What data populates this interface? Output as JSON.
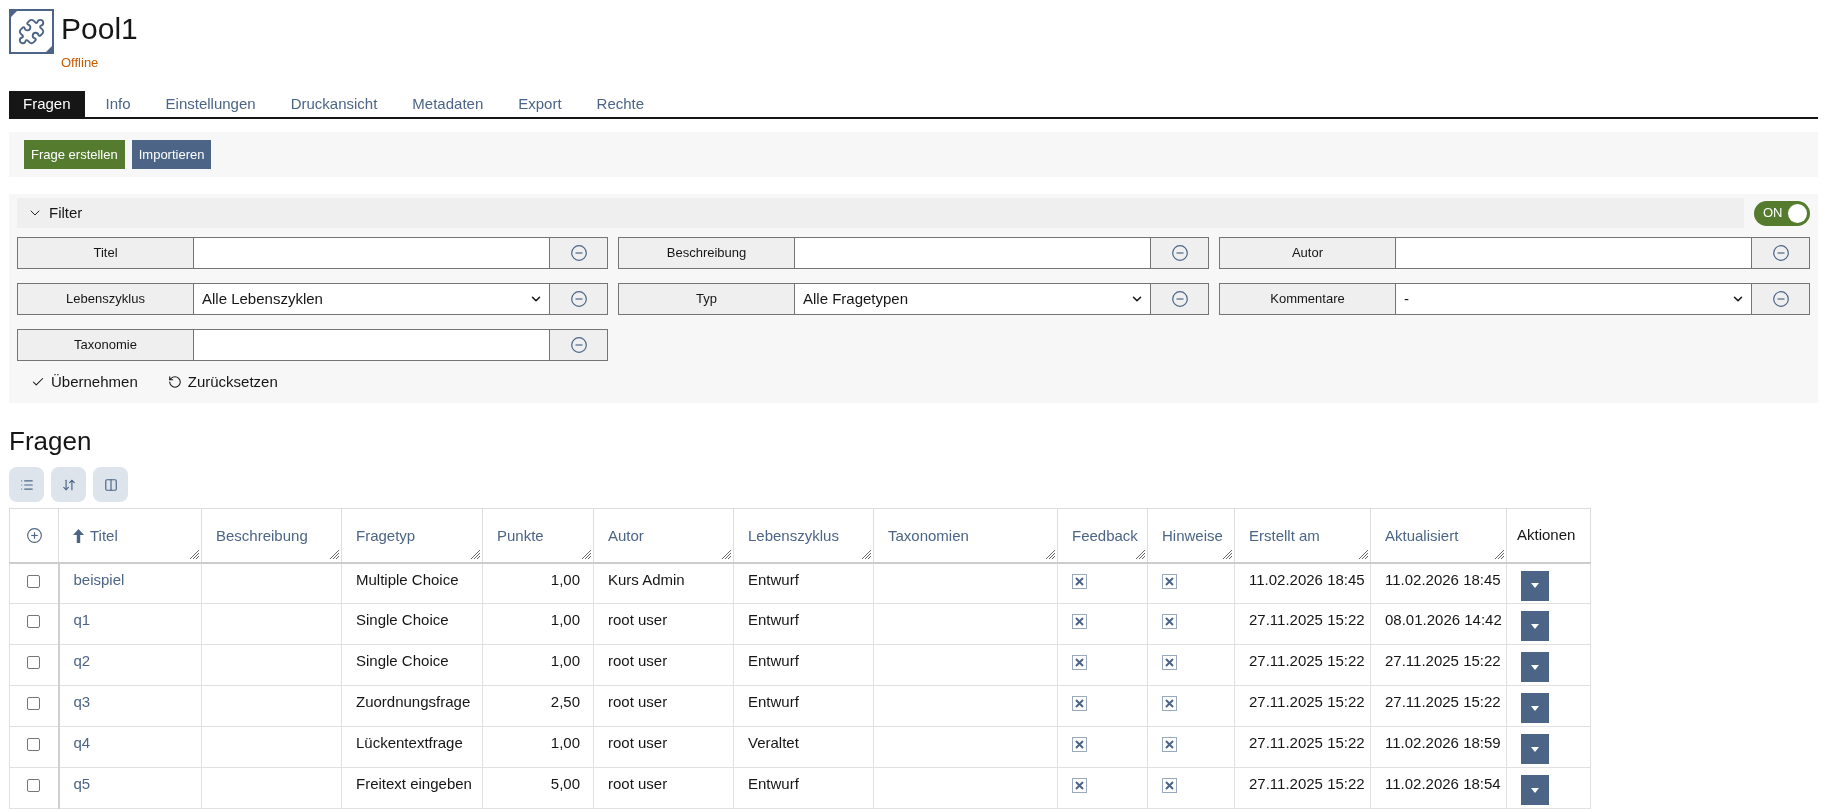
{
  "header": {
    "title": "Pool1",
    "status": "Offline"
  },
  "tabs": [
    {
      "label": "Fragen",
      "selected": true
    },
    {
      "label": "Info",
      "selected": false
    },
    {
      "label": "Einstellungen",
      "selected": false
    },
    {
      "label": "Druckansicht",
      "selected": false
    },
    {
      "label": "Metadaten",
      "selected": false
    },
    {
      "label": "Export",
      "selected": false
    },
    {
      "label": "Rechte",
      "selected": false
    }
  ],
  "toolbar": {
    "buttons": [
      {
        "label": "Frage erstellen",
        "kind": "primary"
      },
      {
        "label": "Importieren",
        "kind": "default"
      }
    ]
  },
  "filter": {
    "title": "Filter",
    "expanded": true,
    "toggle": {
      "label": "ON",
      "on": true
    },
    "fields": [
      {
        "label": "Titel",
        "kind": "text"
      },
      {
        "label": "Beschreibung",
        "kind": "text"
      },
      {
        "label": "Autor",
        "kind": "text"
      },
      {
        "label": "Lebenszyklus",
        "kind": "select",
        "value": "Alle Lebenszyklen"
      },
      {
        "label": "Typ",
        "kind": "select",
        "value": "Alle Fragetypen"
      },
      {
        "label": "Kommentare",
        "kind": "select",
        "value": "-"
      },
      {
        "label": "Taxonomie",
        "kind": "text"
      }
    ],
    "actions": [
      {
        "label": "Übernehmen",
        "kind": "apply"
      },
      {
        "label": "Zurücksetzen",
        "kind": "reset"
      }
    ]
  },
  "table": {
    "title": "Fragen",
    "columns": [
      {
        "label": "Titel",
        "sortable": true,
        "sorted": true
      },
      {
        "label": "Beschreibung",
        "sortable": true,
        "sorted": false
      },
      {
        "label": "Fragetyp",
        "sortable": true,
        "sorted": false
      },
      {
        "label": "Punkte",
        "sortable": true,
        "sorted": false
      },
      {
        "label": "Autor",
        "sortable": true,
        "sorted": false
      },
      {
        "label": "Lebenszyklus",
        "sortable": true,
        "sorted": false
      },
      {
        "label": "Taxonomien",
        "sortable": true,
        "sorted": false
      },
      {
        "label": "Feedback",
        "sortable": true,
        "sorted": false
      },
      {
        "label": "Hinweise",
        "sortable": true,
        "sorted": false
      },
      {
        "label": "Erstellt am",
        "sortable": true,
        "sorted": false
      },
      {
        "label": "Aktualisiert",
        "sortable": true,
        "sorted": false
      },
      {
        "label": "Aktionen",
        "sortable": false,
        "sorted": false
      }
    ],
    "rows": [
      {
        "checked": false,
        "title": "beispiel",
        "type": "Multiple Choice",
        "points": "1,00",
        "author": "Kurs Admin",
        "lifecycle": "Entwurf",
        "feedback": false,
        "hints": false,
        "created": "11.02.2026 18:45",
        "updated": "11.02.2026 18:45"
      },
      {
        "checked": false,
        "title": "q1",
        "type": "Single Choice",
        "points": "1,00",
        "author": "root user",
        "lifecycle": "Entwurf",
        "feedback": false,
        "hints": false,
        "created": "27.11.2025 15:22",
        "updated": "08.01.2026 14:42"
      },
      {
        "checked": false,
        "title": "q2",
        "type": "Single Choice",
        "points": "1,00",
        "author": "root user",
        "lifecycle": "Entwurf",
        "feedback": false,
        "hints": false,
        "created": "27.11.2025 15:22",
        "updated": "27.11.2025 15:22"
      },
      {
        "checked": false,
        "title": "q3",
        "type": "Zuordnungsfrage",
        "points": "2,50",
        "author": "root user",
        "lifecycle": "Entwurf",
        "feedback": false,
        "hints": false,
        "created": "27.11.2025 15:22",
        "updated": "27.11.2025 15:22"
      },
      {
        "checked": false,
        "title": "q4",
        "type": "Lückentextfrage",
        "points": "1,00",
        "author": "root user",
        "lifecycle": "Veraltet",
        "feedback": false,
        "hints": false,
        "created": "27.11.2025 15:22",
        "updated": "11.02.2026 18:59"
      },
      {
        "checked": false,
        "title": "q5",
        "type": "Freitext eingeben",
        "points": "5,00",
        "author": "root user",
        "lifecycle": "Entwurf",
        "feedback": false,
        "hints": false,
        "created": "27.11.2025 15:22",
        "updated": "11.02.2026 18:54"
      }
    ]
  }
}
